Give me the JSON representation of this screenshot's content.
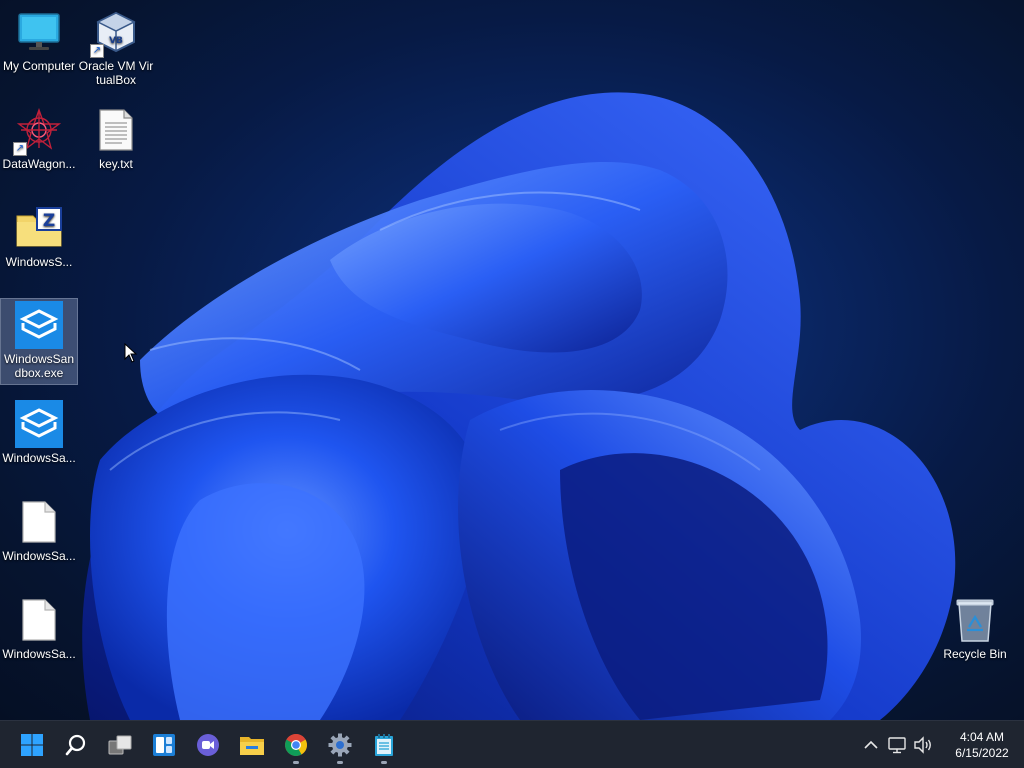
{
  "desktop": {
    "icons": [
      {
        "label": "My Computer",
        "icon": "monitor-icon"
      },
      {
        "label": "Oracle VM VirtualBox",
        "icon": "virtualbox-icon",
        "shortcut": true
      },
      {
        "label": "DataWagon...",
        "icon": "datawagon-icon",
        "shortcut": true
      },
      {
        "label": "key.txt",
        "icon": "text-file-icon"
      },
      {
        "label": "WindowsS...",
        "icon": "zip-folder-icon"
      },
      {
        "label": "WindowsSandbox.exe",
        "icon": "sandbox-icon",
        "selected": true
      },
      {
        "label": "WindowsSa...",
        "icon": "sandbox-icon"
      },
      {
        "label": "WindowsSa...",
        "icon": "blank-file-icon"
      },
      {
        "label": "WindowsSa...",
        "icon": "blank-file-icon"
      },
      {
        "label": "Recycle Bin",
        "icon": "recycle-bin-icon"
      }
    ]
  },
  "taskbar": {
    "buttons": [
      {
        "name": "start",
        "icon": "windows-logo-icon"
      },
      {
        "name": "search",
        "icon": "search-icon"
      },
      {
        "name": "task-view",
        "icon": "task-view-icon"
      },
      {
        "name": "widgets",
        "icon": "widgets-icon"
      },
      {
        "name": "chat",
        "icon": "chat-icon"
      },
      {
        "name": "file-explorer",
        "icon": "folder-icon"
      },
      {
        "name": "chrome",
        "icon": "chrome-icon",
        "running": true
      },
      {
        "name": "settings",
        "icon": "gear-icon",
        "running": true
      },
      {
        "name": "notepad",
        "icon": "notepad-icon",
        "running": true
      }
    ],
    "tray": {
      "icons": [
        "chevron-up-icon",
        "network-icon",
        "volume-icon"
      ],
      "time": "4:04 AM",
      "date": "6/15/2022"
    }
  },
  "colors": {
    "taskbar_bg": "#1f2530",
    "wallpaper_blue": "#1a4fe0",
    "selection": "#c8dcff"
  }
}
